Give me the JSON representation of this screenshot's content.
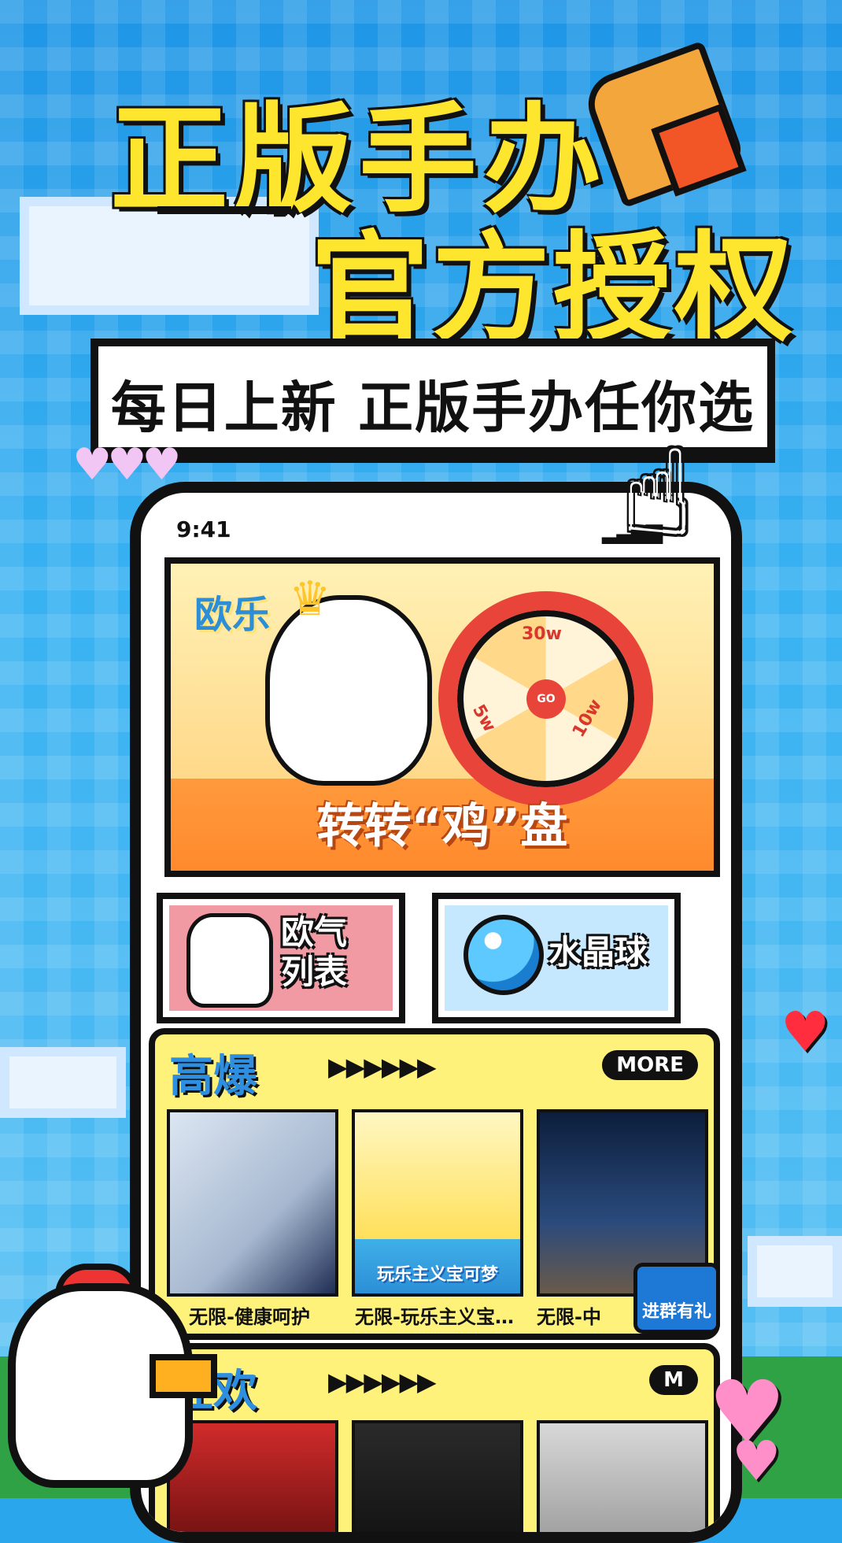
{
  "headline": {
    "line1": "正版手办",
    "line2": "官方授权"
  },
  "tagline": "每日上新 正版手办任你选",
  "status": {
    "time": "9:41"
  },
  "hero": {
    "logo": "欧乐",
    "wheel": {
      "center": "GO",
      "label_top": "30w",
      "label_left": "5w",
      "label_right": "10w"
    },
    "cta": "转转“鸡”盘"
  },
  "cards": [
    {
      "label_line1": "欧气",
      "label_line2": "列表",
      "icon": "chicken-icon"
    },
    {
      "label": "水晶球",
      "icon": "crystal-ball-icon"
    }
  ],
  "section_hot": {
    "title": "高爆",
    "arrows": "▶▶▶▶▶▶",
    "more": "MORE",
    "products": [
      {
        "name": "无限-健康呵护"
      },
      {
        "name": "无限-玩乐主义宝…",
        "image_text": "玩乐主义宝可梦"
      },
      {
        "name": "无限-中"
      }
    ],
    "float_button": "进群有礼"
  },
  "section_carnival": {
    "title": "狂欢",
    "arrows": "▶▶▶▶▶▶",
    "more": "M"
  },
  "colors": {
    "sky": "#2aa6ec",
    "headline_yellow": "#ffe62e",
    "section_yellow": "#fff27a",
    "wheel_red": "#e9443a",
    "outline": "#111111"
  }
}
